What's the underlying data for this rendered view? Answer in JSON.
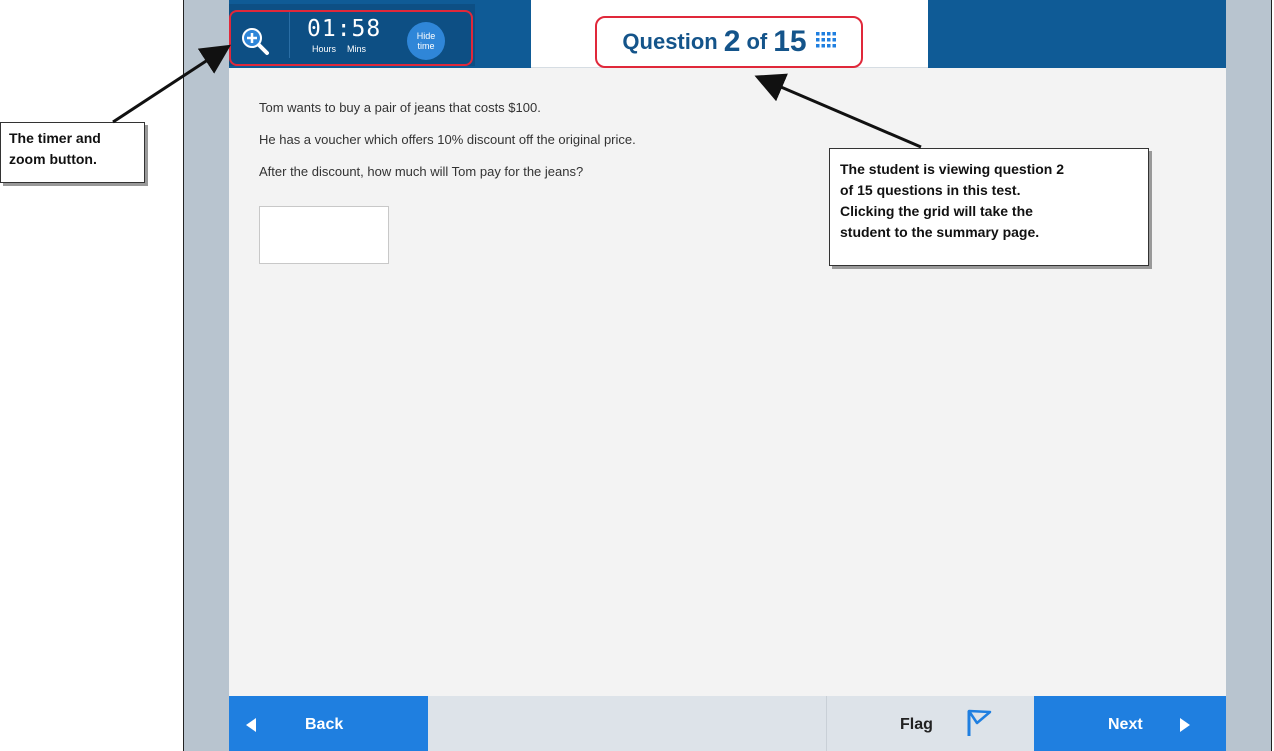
{
  "header": {
    "timer": {
      "time": "01:58",
      "hours_label": "Hours",
      "mins_label": "Mins",
      "hide_line1": "Hide",
      "hide_line2": "time"
    },
    "question_counter": {
      "prefix": "Question",
      "current": "2",
      "of": "of",
      "total": "15"
    }
  },
  "question": {
    "lines": [
      "Tom wants to buy a pair of jeans that costs $100.",
      "He has a voucher which offers 10% discount off the original price.",
      "After the discount, how much will Tom pay for the jeans?"
    ],
    "answer_value": ""
  },
  "footer": {
    "back_label": "Back",
    "flag_label": "Flag",
    "next_label": "Next"
  },
  "callouts": {
    "timer": [
      "The timer and",
      "zoom button."
    ],
    "question": [
      "The student is viewing question 2",
      "of 15 questions in this test.",
      "Clicking the grid will take the",
      "student to the summary page."
    ]
  },
  "colors": {
    "header_blue": "#0f5b96",
    "button_blue": "#1f7fe0",
    "highlight_red": "#e0283a",
    "counter_text": "#14548a"
  },
  "icons": {
    "zoom": "zoom-in-icon",
    "grid": "grid-icon",
    "flag": "flag-icon",
    "back": "triangle-left-icon",
    "next": "triangle-right-icon"
  }
}
